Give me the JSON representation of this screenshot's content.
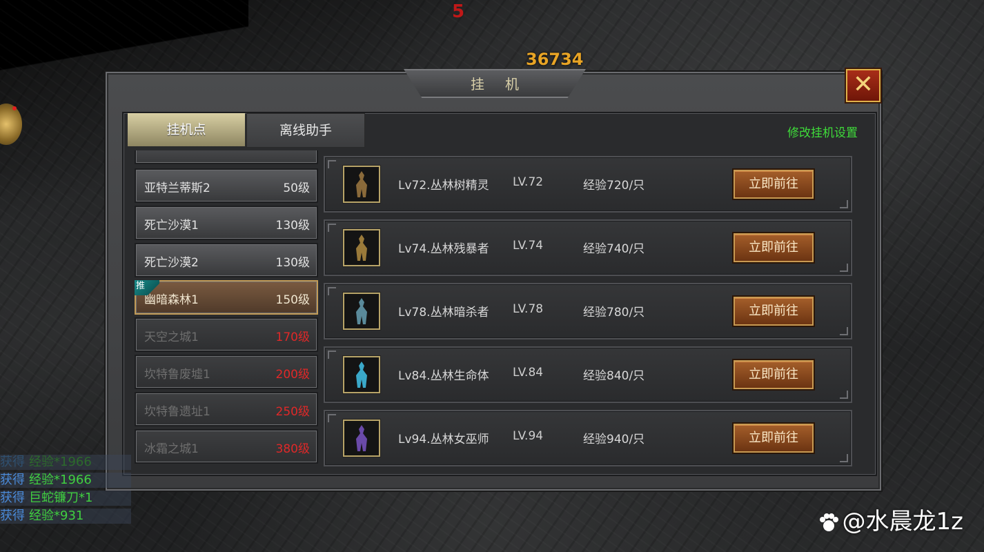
{
  "scene": {
    "damage_red": "5",
    "damage_gold": "36734"
  },
  "dialog": {
    "title": "挂机",
    "close_glyph": "✕",
    "tabs": [
      {
        "label": "挂机点",
        "active": true
      },
      {
        "label": "离线助手",
        "active": false
      }
    ],
    "settings_link": "修改挂机设置",
    "recommend_tag": "推"
  },
  "maps": [
    {
      "name": "亚特兰蒂斯2",
      "level": "50级",
      "locked": false
    },
    {
      "name": "死亡沙漠1",
      "level": "130级",
      "locked": false
    },
    {
      "name": "死亡沙漠2",
      "level": "130级",
      "locked": false
    },
    {
      "name": "幽暗森林1",
      "level": "150级",
      "locked": false,
      "selected": true,
      "recommended": true
    },
    {
      "name": "天空之城1",
      "level": "170级",
      "locked": true
    },
    {
      "name": "坎特鲁废墟1",
      "level": "200级",
      "locked": true
    },
    {
      "name": "坎特鲁遗址1",
      "level": "250级",
      "locked": true
    },
    {
      "name": "冰霜之城1",
      "level": "380级",
      "locked": true
    }
  ],
  "monsters": [
    {
      "name": "Lv72.丛林树精灵",
      "lv": "LV.72",
      "exp": "经验720/只",
      "button": "立即前往",
      "color": "#8a6a3a"
    },
    {
      "name": "Lv74.丛林残暴者",
      "lv": "LV.74",
      "exp": "经验740/只",
      "button": "立即前往",
      "color": "#9a7a3a"
    },
    {
      "name": "Lv78.丛林暗杀者",
      "lv": "LV.78",
      "exp": "经验780/只",
      "button": "立即前往",
      "color": "#5a8a9a"
    },
    {
      "name": "Lv84.丛林生命体",
      "lv": "LV.84",
      "exp": "经验840/只",
      "button": "立即前往",
      "color": "#3aa8c8"
    },
    {
      "name": "Lv94.丛林女巫师",
      "lv": "LV.94",
      "exp": "经验940/只",
      "button": "立即前往",
      "color": "#6a4aa8"
    }
  ],
  "chat": [
    {
      "label": "获得",
      "value": "经验*1966",
      "faded": true
    },
    {
      "label": "获得",
      "value": "经验*1966",
      "faded": false
    },
    {
      "label": "获得",
      "value": "巨蛇镰刀*1",
      "faded": false
    },
    {
      "label": "获得",
      "value": "经验*931",
      "faded": false
    }
  ],
  "watermark": "@水晨龙1z"
}
